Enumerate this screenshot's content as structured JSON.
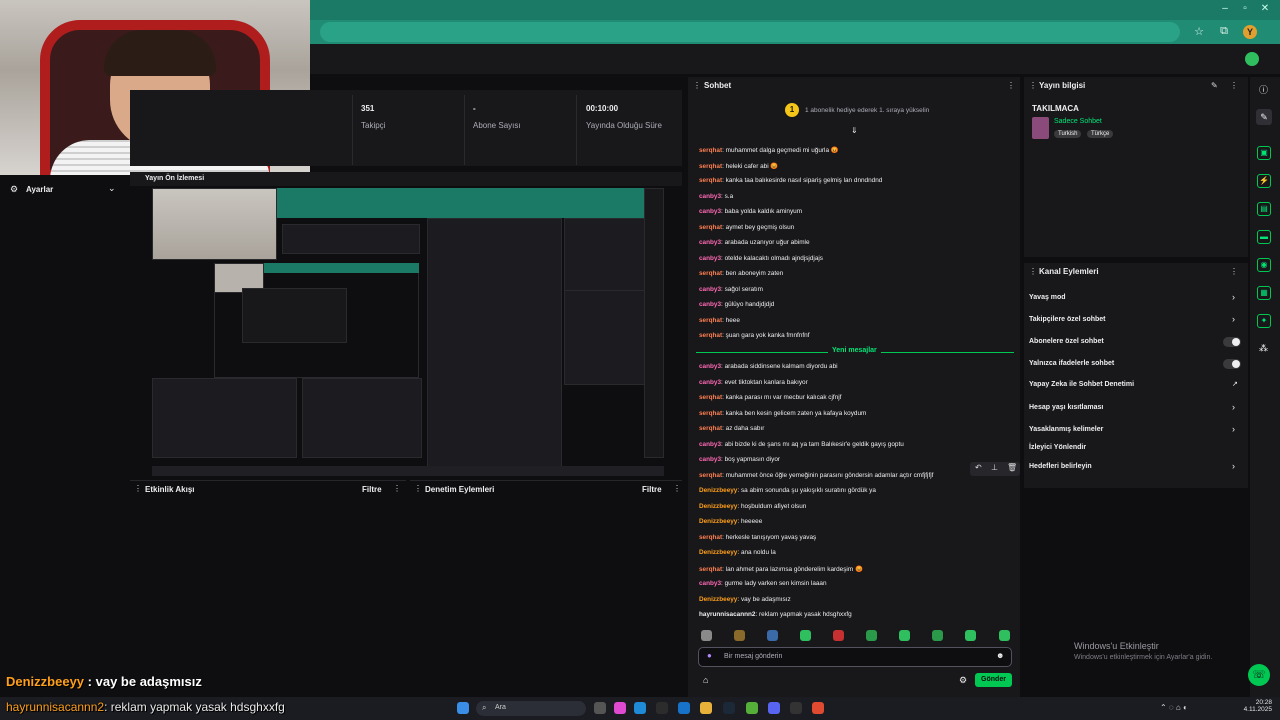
{
  "browser": {
    "profile_initial": "Y"
  },
  "left": {
    "settings_label": "Ayarlar"
  },
  "stats": [
    {
      "value": "351",
      "label": "Takipçi"
    },
    {
      "value": "-",
      "label": "Abone Sayısı"
    },
    {
      "value": "00:10:00",
      "label": "Yayında Olduğu Süre"
    }
  ],
  "preview": {
    "title": "Yayın Ön İzlemesi"
  },
  "activity": {
    "title": "Etkinlik Akışı",
    "filter": "Filtre"
  },
  "moderation": {
    "title": "Denetim Eylemleri",
    "filter": "Filtre"
  },
  "chat": {
    "title": "Sohbet",
    "gift_banner": "1 abonelik hediye ederek 1. sıraya yükselin",
    "new_messages": "Yeni mesajlar",
    "input_placeholder": "Bir mesaj gönderin",
    "send": "Gönder",
    "messages": [
      {
        "user": "serqhat",
        "color": "#ff7f50",
        "text": "muhammet dalga geçmedi mi uğurla 😡"
      },
      {
        "user": "serqhat",
        "color": "#ff7f50",
        "text": "heleki cafer abi 😡"
      },
      {
        "user": "serqhat",
        "color": "#ff7f50",
        "text": "kanka taa balıkesirde nasıl sipariş gelmiş lan dnndndnd"
      },
      {
        "user": "canby3",
        "color": "#ff69b4",
        "text": "s.a"
      },
      {
        "user": "canby3",
        "color": "#ff69b4",
        "text": "baba yolda kaldık aminyum"
      },
      {
        "user": "serqhat",
        "color": "#ff7f50",
        "text": "aymet bey geçmiş olsun"
      },
      {
        "user": "canby3",
        "color": "#ff69b4",
        "text": "arabada uzanıyor uğur abimle"
      },
      {
        "user": "canby3",
        "color": "#ff69b4",
        "text": "otelde kalacaktı olmadı ajndjsjdjajs"
      },
      {
        "user": "serqhat",
        "color": "#ff7f50",
        "text": "ben aboneyim zaten"
      },
      {
        "user": "canby3",
        "color": "#ff69b4",
        "text": "sağol seratım"
      },
      {
        "user": "canby3",
        "color": "#ff69b4",
        "text": "gülüyo handjdjdjd"
      },
      {
        "user": "serqhat",
        "color": "#ff7f50",
        "text": "heee"
      },
      {
        "user": "serqhat",
        "color": "#ff7f50",
        "text": "şuan gara yok kanka fmnfnfnf"
      },
      {
        "user": "canby3",
        "color": "#ff69b4",
        "text": "arabada siddinsene kalmam diyordu abi"
      },
      {
        "user": "canby3",
        "color": "#ff69b4",
        "text": "evet tiktoktan kanlara bakıyor"
      },
      {
        "user": "serqhat",
        "color": "#ff7f50",
        "text": "kanka parası mı var mecbur kalıcak cjfnjf"
      },
      {
        "user": "serqhat",
        "color": "#ff7f50",
        "text": "kanka ben kesin gelicem zaten ya kafaya koydum"
      },
      {
        "user": "serqhat",
        "color": "#ff7f50",
        "text": "az daha sabır"
      },
      {
        "user": "canby3",
        "color": "#ff69b4",
        "text": "abi bizde ki de şans mı aq ya tam Balıkesir'e geldik gayış goptu"
      },
      {
        "user": "canby3",
        "color": "#ff69b4",
        "text": "boş yapmasın diyor"
      },
      {
        "user": "serqhat",
        "color": "#ff7f50",
        "text": "muhammet önce öğle yemeğinin parasını göndersin adamlar açtır cmfjfjfjf"
      },
      {
        "user": "Denizzbeeyy",
        "color": "#ff9f1a",
        "text": "sa abim sonunda şu yakışıklı suratını gördük ya"
      },
      {
        "user": "Denizzbeeyy",
        "color": "#ff9f1a",
        "text": "hoşbuldum afiyet olsun"
      },
      {
        "user": "Denizzbeeyy",
        "color": "#ff9f1a",
        "text": "heeeee"
      },
      {
        "user": "serqhat",
        "color": "#ff7f50",
        "text": "herkesle tanışıyom yavaş yavaş"
      },
      {
        "user": "Denizzbeeyy",
        "color": "#ff9f1a",
        "text": "ana noldu la"
      },
      {
        "user": "serqhat",
        "color": "#ff7f50",
        "text": "lan ahmet para lazımsa gönderelim kardeşim 😡"
      },
      {
        "user": "canby3",
        "color": "#ff69b4",
        "text": "gurme lady varken sen kimsin laaan"
      },
      {
        "user": "Denizzbeeyy",
        "color": "#ff9f1a",
        "text": "vay be adaşmısız"
      },
      {
        "user": "hayrunnisacannn2",
        "color": "#efeff1",
        "text": "reklam yapmak yasak hdsghxxfg"
      }
    ]
  },
  "stream_info": {
    "title": "Yayın bilgisi",
    "stream_title": "TAKILMACA",
    "category": "Sadece Sohbet",
    "tags": [
      "Turkish",
      "Türkçe"
    ]
  },
  "channel_actions": {
    "title": "Kanal Eylemleri",
    "items": [
      "Yavaş mod",
      "Takipçilere özel sohbet",
      "Abonelere özel sohbet",
      "Yalnızca ifadelerle sohbet",
      "Yapay Zeka ile Sohbet Denetimi",
      "Hesap yaşı kısıtlaması",
      "Yasaklanmış kelimeler",
      "İzleyici Yönlendir",
      "Hedefleri belirleyin"
    ]
  },
  "overlay": {
    "line1_user": "Denizzbeeyy",
    "line1_text": ": vay be adaşmısız",
    "line2_user": "hayrunnisacannn2",
    "line2_text": ": reklam yapmak yasak hdsghxxfg"
  },
  "windows": {
    "activate_title": "Windows'u Etkinleştir",
    "activate_sub": "Windows'u etkinleştirmek için Ayarlar'a gidin.",
    "search": "Ara",
    "time": "20:28",
    "date": "4.11.2025"
  }
}
